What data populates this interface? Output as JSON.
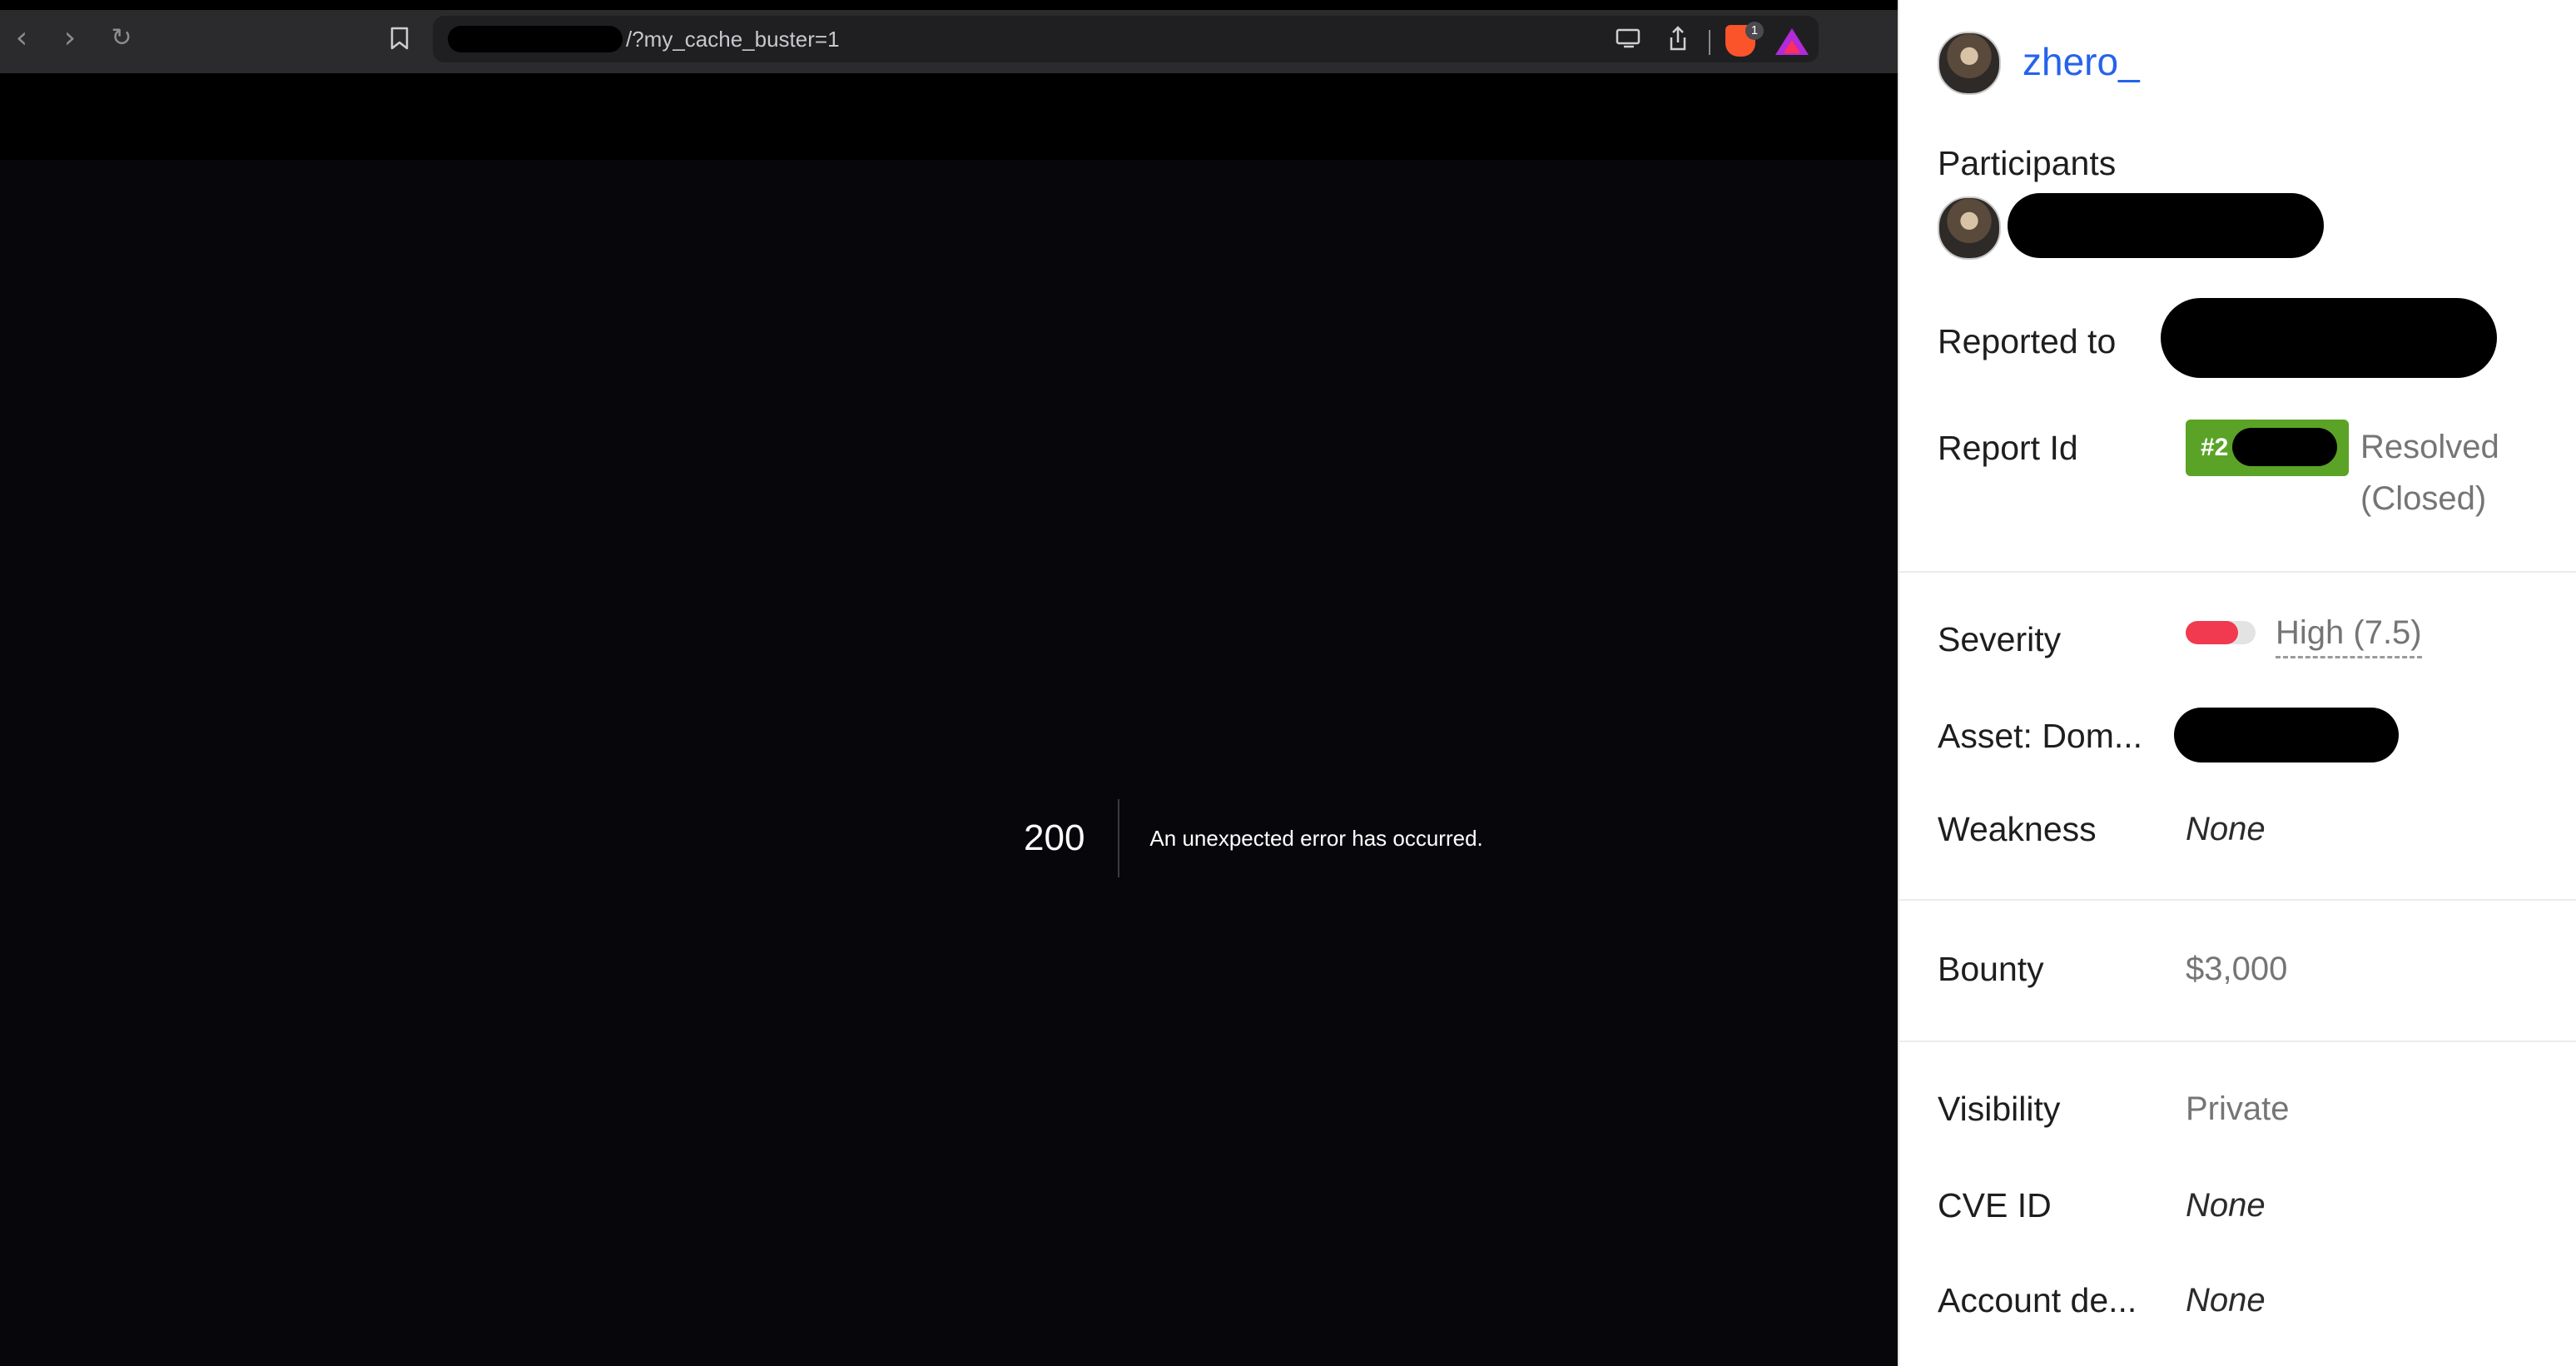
{
  "browser": {
    "address_bar": {
      "url_suffix": "/?my_cache_buster=1"
    },
    "icons": {
      "back": "chevron-left-icon",
      "forward": "chevron-right-icon",
      "reload": "reload-icon",
      "bookmark": "bookmark-icon",
      "cast": "cast-icon",
      "share": "share-icon",
      "brave_shields": "brave-shields-icon",
      "brave_shields_badge": "1",
      "vpn": "aurora-vpn-icon"
    },
    "page": {
      "status_code": "200",
      "message": "An unexpected error has occurred."
    }
  },
  "report_panel": {
    "reporter": {
      "username": "zhero_"
    },
    "fields": {
      "participants_label": "Participants",
      "reported_to_label": "Reported to",
      "report_id_label": "Report Id",
      "report_id_prefix": "#2",
      "status": "Resolved (Closed)",
      "severity_label": "Severity",
      "severity_value": "High (7.5)",
      "severity_level": 0.75,
      "asset_label": "Asset: Dom...",
      "weakness_label": "Weakness",
      "weakness_value": "None",
      "bounty_label": "Bounty",
      "bounty_value": "$3,000",
      "visibility_label": "Visibility",
      "visibility_value": "Private",
      "cve_label": "CVE ID",
      "cve_value": "None",
      "account_label": "Account de...",
      "account_value": "None"
    },
    "colors": {
      "link": "#2563eb",
      "resolved_pill": "#5aa326",
      "severity_high": "#f1394f"
    }
  }
}
